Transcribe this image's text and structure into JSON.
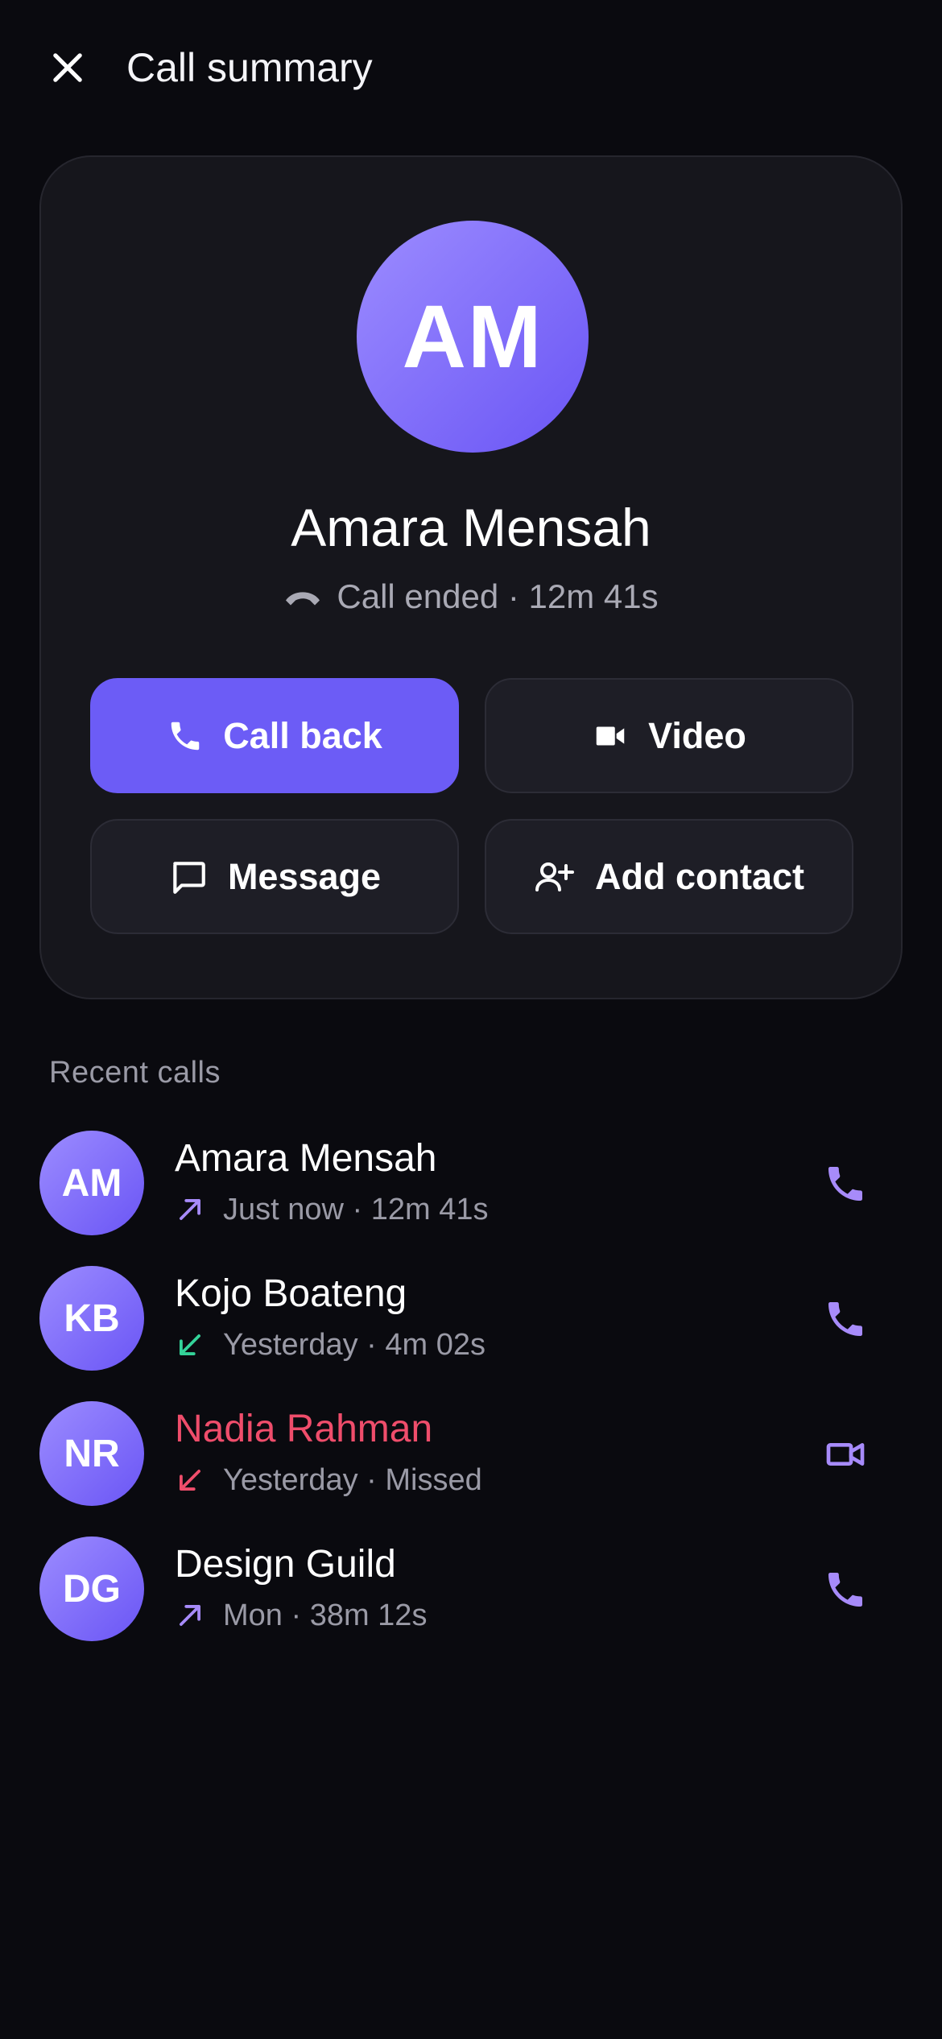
{
  "header": {
    "title": "Call summary"
  },
  "summary": {
    "initials": "AM",
    "name": "Amara Mensah",
    "status": "Call ended · 12m 41s"
  },
  "actions": {
    "call_back": "Call back",
    "video": "Video",
    "message": "Message",
    "add_contact": "Add contact"
  },
  "recent": {
    "label": "Recent calls",
    "calls": [
      {
        "initials": "AM",
        "name": "Amara Mensah",
        "meta": "Just now · 12m 41s",
        "direction": "outgoing",
        "kind": "voice"
      },
      {
        "initials": "KB",
        "name": "Kojo Boateng",
        "meta": "Yesterday · 4m 02s",
        "direction": "incoming",
        "kind": "voice"
      },
      {
        "initials": "NR",
        "name": "Nadia Rahman",
        "meta": "Yesterday · Missed",
        "direction": "missed",
        "kind": "video"
      },
      {
        "initials": "DG",
        "name": "Design Guild",
        "meta": "Mon · 38m 12s",
        "direction": "outgoing",
        "kind": "voice"
      }
    ]
  },
  "colors": {
    "background": "#0a0a0f",
    "card": "#16161c",
    "accent": "#6c5cf6",
    "icon_accent": "#a78bfa",
    "incoming": "#34d399",
    "missed": "#ef4d6b"
  },
  "icons": {
    "close": "close-icon",
    "status": "call-ended-icon",
    "call_back": "phone-icon",
    "video": "video-camera-icon",
    "message": "chat-bubble-icon",
    "add_contact": "add-person-icon"
  }
}
